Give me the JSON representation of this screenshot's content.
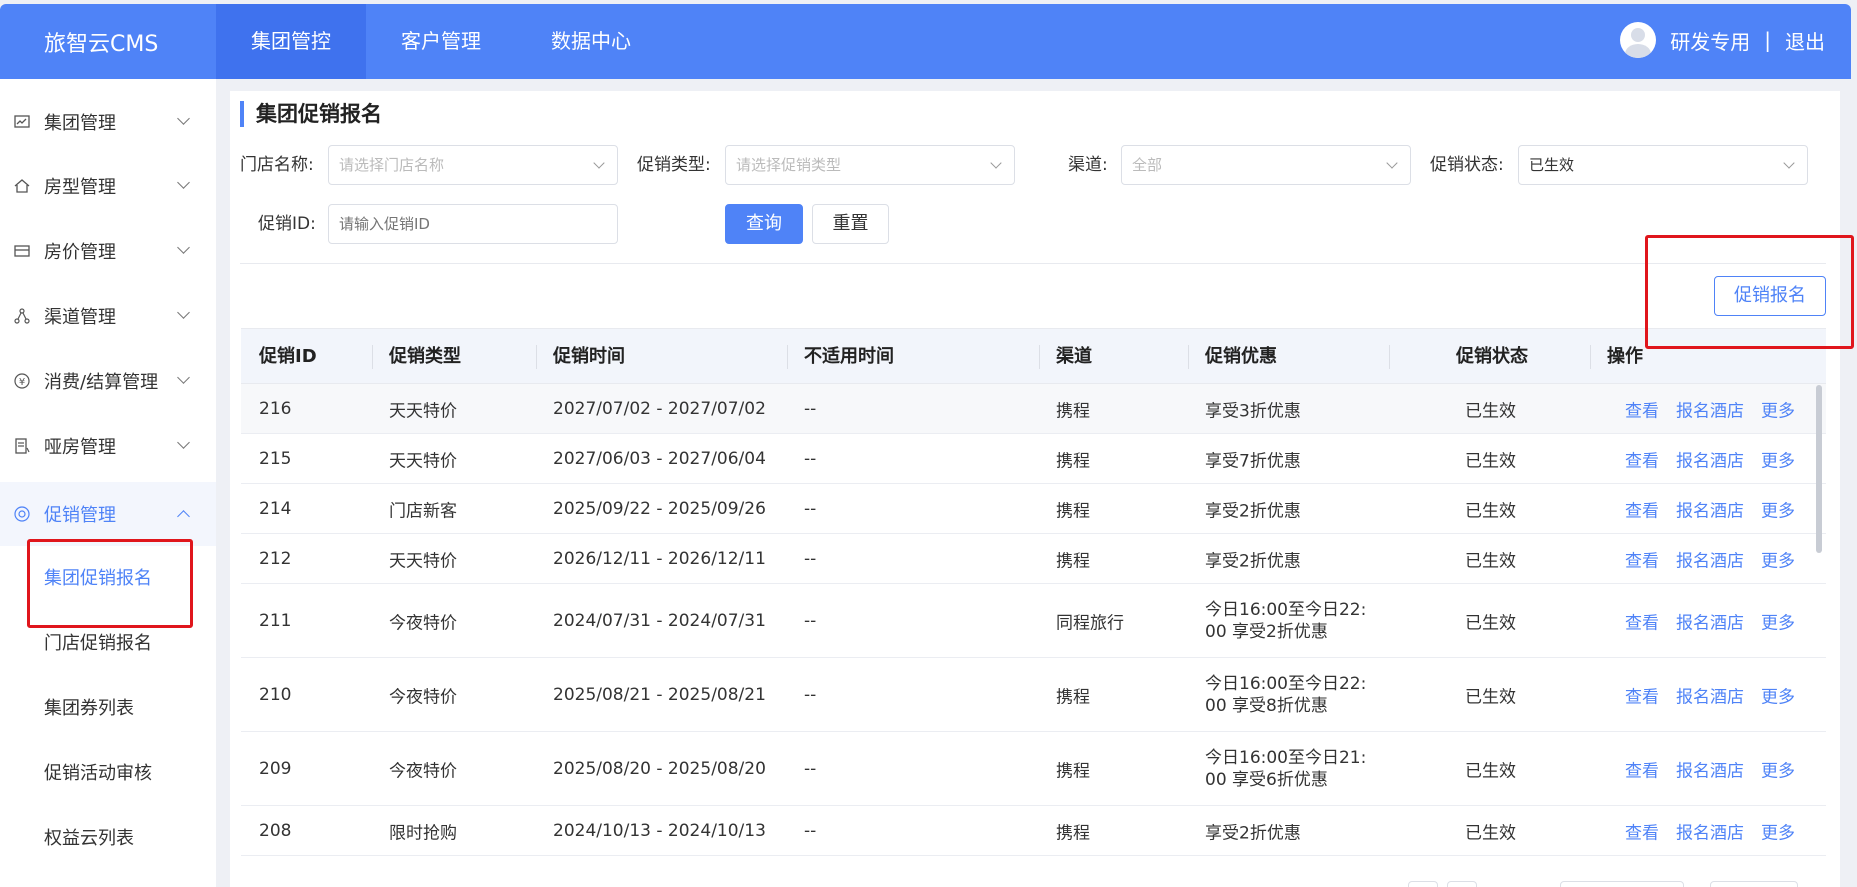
{
  "app": {
    "title": "旅智云CMS"
  },
  "topnav": {
    "items": [
      {
        "label": "集团管控"
      },
      {
        "label": "客户管理"
      },
      {
        "label": "数据中心"
      }
    ]
  },
  "user": {
    "name": "研发专用",
    "separator": "|",
    "logout": "退出"
  },
  "sidebar": {
    "menus": [
      {
        "label": "集团管理",
        "icon": "chart-icon"
      },
      {
        "label": "房型管理",
        "icon": "home-icon"
      },
      {
        "label": "房价管理",
        "icon": "wallet-icon"
      },
      {
        "label": "渠道管理",
        "icon": "network-icon"
      },
      {
        "label": "消费/结算管理",
        "icon": "yen-icon"
      },
      {
        "label": "哑房管理",
        "icon": "document-icon"
      },
      {
        "label": "促销管理",
        "icon": "promo-icon"
      }
    ],
    "submenu": [
      {
        "label": "集团促销报名"
      },
      {
        "label": "门店促销报名"
      },
      {
        "label": "集团券列表"
      },
      {
        "label": "促销活动审核"
      },
      {
        "label": "权益云列表"
      }
    ]
  },
  "page": {
    "title": "集团促销报名"
  },
  "filters": {
    "store_label": "门店名称:",
    "store_placeholder": "请选择门店名称",
    "type_label": "促销类型:",
    "type_placeholder": "请选择促销类型",
    "channel_label": "渠道:",
    "channel_placeholder": "全部",
    "status_label": "促销状态:",
    "status_value": "已生效",
    "id_label": "促销ID:",
    "id_placeholder": "请输入促销ID",
    "query_button": "查询",
    "reset_button": "重置"
  },
  "actions": {
    "register_button": "促销报名"
  },
  "table": {
    "headers": [
      "促销ID",
      "促销类型",
      "促销时间",
      "不适用时间",
      "渠道",
      "促销优惠",
      "促销状态",
      "操作"
    ],
    "action_labels": [
      "查看",
      "报名酒店",
      "更多"
    ],
    "rows": [
      {
        "id": "216",
        "type": "天天特价",
        "time": "2027/07/02 - 2027/07/02",
        "excluded": "--",
        "channel": "携程",
        "discount": "享受3折优惠",
        "status": "已生效"
      },
      {
        "id": "215",
        "type": "天天特价",
        "time": "2027/06/03 - 2027/06/04",
        "excluded": "--",
        "channel": "携程",
        "discount": "享受7折优惠",
        "status": "已生效"
      },
      {
        "id": "214",
        "type": "门店新客",
        "time": "2025/09/22 - 2025/09/26",
        "excluded": "--",
        "channel": "携程",
        "discount": "享受2折优惠",
        "status": "已生效"
      },
      {
        "id": "212",
        "type": "天天特价",
        "time": "2026/12/11 - 2026/12/11",
        "excluded": "--",
        "channel": "携程",
        "discount": "享受2折优惠",
        "status": "已生效"
      },
      {
        "id": "211",
        "type": "今夜特价",
        "time": "2024/07/31 - 2024/07/31",
        "excluded": "--",
        "channel": "同程旅行",
        "discount": "今日16:00至今日22:00 享受2折优惠",
        "status": "已生效"
      },
      {
        "id": "210",
        "type": "今夜特价",
        "time": "2025/08/21 - 2025/08/21",
        "excluded": "--",
        "channel": "携程",
        "discount": "今日16:00至今日22:00 享受8折优惠",
        "status": "已生效"
      },
      {
        "id": "209",
        "type": "今夜特价",
        "time": "2025/08/20 - 2025/08/20",
        "excluded": "--",
        "channel": "携程",
        "discount": "今日16:00至今日21:00 享受6折优惠",
        "status": "已生效"
      },
      {
        "id": "208",
        "type": "限时抢购",
        "time": "2024/10/13 - 2024/10/13",
        "excluded": "--",
        "channel": "携程",
        "discount": "享受2折优惠",
        "status": "已生效"
      }
    ]
  },
  "colors": {
    "brand": "#4f83f7",
    "highlight": "#e0161c"
  }
}
